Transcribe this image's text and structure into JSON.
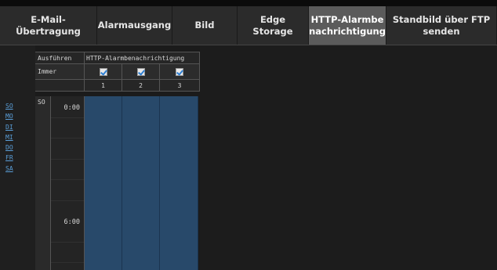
{
  "tabs": [
    {
      "label": "E-Mail-Übertragung",
      "active": false
    },
    {
      "label": "Alarmausgang",
      "active": false
    },
    {
      "label": "Bild",
      "active": false
    },
    {
      "label": "Edge Storage",
      "active": false
    },
    {
      "label": "HTTP-Alarmbe nachrichtigung",
      "active": true
    },
    {
      "label": "Standbild über FTP senden",
      "active": false
    }
  ],
  "days": [
    "SO",
    "MO",
    "DI",
    "MI",
    "DO",
    "FR",
    "SA"
  ],
  "schedule": {
    "header_execute": "Ausführen",
    "header_action": "HTTP-Alarmbenachrichtigung",
    "row_always": "Immer",
    "columns": [
      "1",
      "2",
      "3"
    ],
    "always_checked": [
      true,
      true,
      true
    ],
    "current_day": "SO",
    "times": [
      "0:00",
      "6:00"
    ]
  },
  "colors": {
    "schedule_fill": "#28496a",
    "active_tab": "#5b5b5b",
    "link": "#5a9ed8",
    "checkmark": "#2e7fd2"
  }
}
